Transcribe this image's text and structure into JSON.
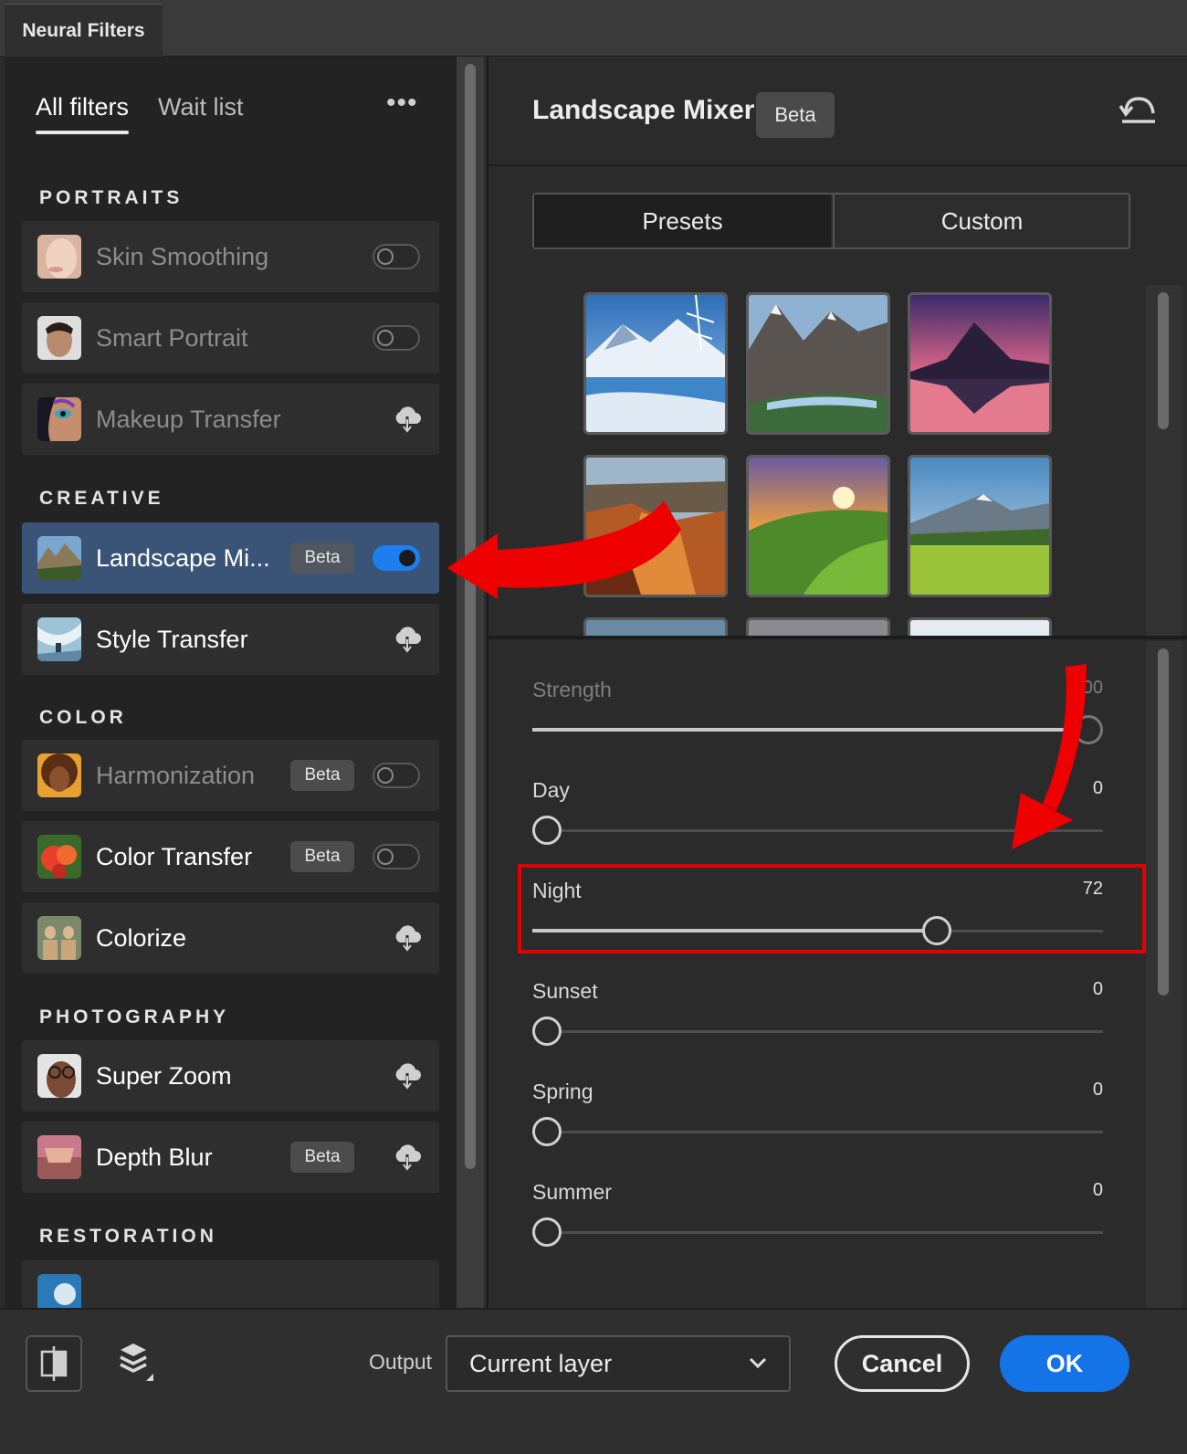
{
  "window": {
    "tab_title": "Neural Filters"
  },
  "nav": {
    "tabs": [
      "All filters",
      "Wait list"
    ],
    "more_label": "•••"
  },
  "sections": {
    "portraits": "PORTRAITS",
    "creative": "CREATIVE",
    "color": "COLOR",
    "photography": "PHOTOGRAPHY",
    "restoration": "RESTORATION"
  },
  "filters": [
    {
      "label": "Skin Smoothing",
      "state": "off",
      "badge": ""
    },
    {
      "label": "Smart Portrait",
      "state": "off",
      "badge": ""
    },
    {
      "label": "Makeup Transfer",
      "state": "download",
      "badge": ""
    },
    {
      "label": "Landscape Mi...",
      "state": "on",
      "badge": "Beta"
    },
    {
      "label": "Style Transfer",
      "state": "download",
      "badge": ""
    },
    {
      "label": "Harmonization",
      "state": "off",
      "badge": "Beta"
    },
    {
      "label": "Color Transfer",
      "state": "off",
      "badge": "Beta"
    },
    {
      "label": "Colorize",
      "state": "download",
      "badge": ""
    },
    {
      "label": "Super Zoom",
      "state": "download",
      "badge": ""
    },
    {
      "label": "Depth Blur",
      "state": "download",
      "badge": "Beta"
    }
  ],
  "panel": {
    "title": "Landscape Mixer",
    "badge": "Beta",
    "tabs": [
      "Presets",
      "Custom"
    ],
    "active_tab": "Presets"
  },
  "presets": [
    "snowy-lake",
    "mountain-valley",
    "sunset-peak",
    "canyon",
    "sunrise-hills",
    "alpine-meadow"
  ],
  "sliders": [
    {
      "label": "Strength",
      "value": "100",
      "level": 1.0,
      "disabled": true
    },
    {
      "label": "Day",
      "value": "0",
      "level": 0
    },
    {
      "label": "Night",
      "value": "72",
      "level": 0.72
    },
    {
      "label": "Sunset",
      "value": "0",
      "level": 0
    },
    {
      "label": "Spring",
      "value": "0",
      "level": 0
    },
    {
      "label": "Summer",
      "value": "0",
      "level": 0
    }
  ],
  "footer": {
    "output_label": "Output",
    "output_value": "Current layer",
    "cancel_label": "Cancel",
    "ok_label": "OK"
  },
  "colors": {
    "accent": "#1473e6",
    "selected_row": "#3a5477",
    "highlight": "#e30000"
  }
}
